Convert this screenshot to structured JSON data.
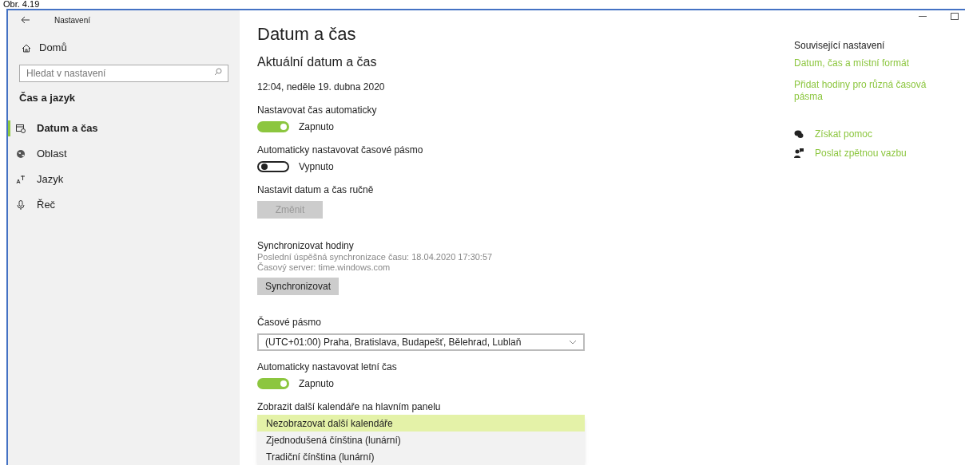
{
  "caption": "Obr. 4.19",
  "window": {
    "title": "Nastavení"
  },
  "sidebar": {
    "home": "Domů",
    "search": {
      "placeholder": "Hledat v nastavení"
    },
    "section": "Čas a jazyk",
    "items": [
      {
        "label": "Datum a čas",
        "kind": "calendar",
        "selected": true
      },
      {
        "label": "Oblast",
        "kind": "globe",
        "selected": false
      },
      {
        "label": "Jazyk",
        "kind": "language",
        "selected": false
      },
      {
        "label": "Řeč",
        "kind": "microphone",
        "selected": false
      }
    ]
  },
  "page": {
    "title": "Datum a čas",
    "subtitle": "Aktuální datum a čas",
    "current": "12:04, neděle 19. dubna 2020",
    "settings": [
      {
        "kind": "toggle",
        "label": "Nastavovat čas automaticky",
        "on": true,
        "state": "Zapnuto"
      },
      {
        "kind": "toggle",
        "label": "Automaticky nastavovat časové pásmo",
        "on": false,
        "state": "Vypnuto"
      },
      {
        "kind": "button",
        "label": "Nastavit datum a čas ručně",
        "button": "Změnit",
        "disabled": true
      },
      {
        "kind": "sync",
        "label": "Synchronizovat hodiny",
        "lines": [
          "Poslední úspěšná synchronizace času: 18.04.2020 17:30:57",
          "Časový server: time.windows.com"
        ],
        "button": "Synchronizovat",
        "disabled": false
      },
      {
        "kind": "select",
        "label": "Časové pásmo",
        "value": "(UTC+01:00) Praha, Bratislava, Budapešť, Bělehrad, Lublaň"
      },
      {
        "kind": "toggle",
        "label": "Automaticky nastavovat letní čas",
        "on": true,
        "state": "Zapnuto"
      },
      {
        "kind": "list",
        "label": "Zobrazit další kalendáře na hlavním panelu",
        "options": [
          {
            "label": "Nezobrazovat další kalendáře",
            "selected": true
          },
          {
            "label": "Zjednodušená čínština (lunární)",
            "selected": false
          },
          {
            "label": "Tradiční čínština (lunární)",
            "selected": false
          }
        ]
      }
    ]
  },
  "related": {
    "title": "Související nastavení",
    "links": [
      "Datum, čas a místní formát",
      "Přidat hodiny pro různá časová pásma"
    ],
    "help": [
      {
        "label": "Získat pomoc",
        "kind": "chat"
      },
      {
        "label": "Poslat zpětnou vazbu",
        "kind": "feedback"
      }
    ]
  }
}
